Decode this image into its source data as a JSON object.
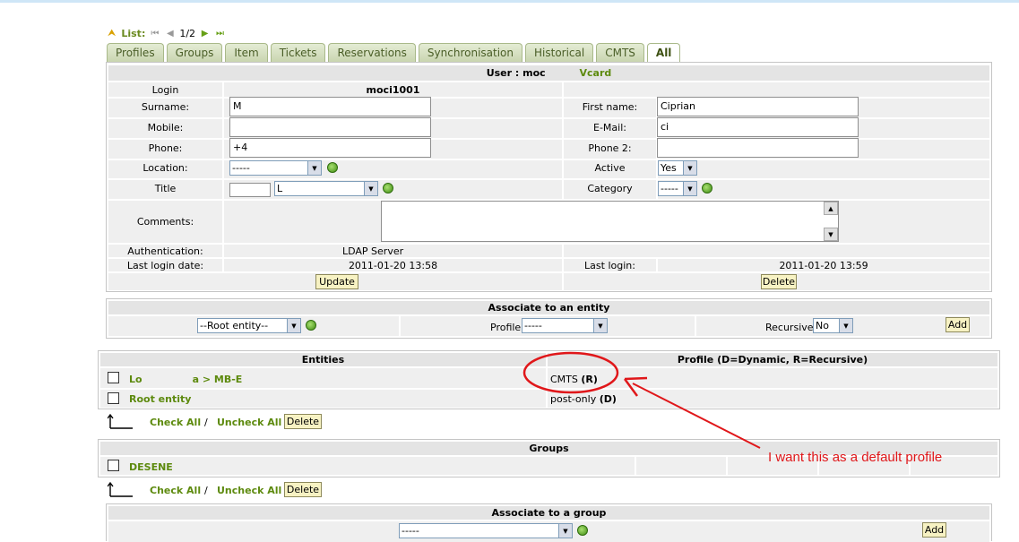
{
  "list_nav": {
    "label": "List:",
    "counter": "1/2"
  },
  "tabs": [
    {
      "label": "Profiles"
    },
    {
      "label": "Groups"
    },
    {
      "label": "Item"
    },
    {
      "label": "Tickets"
    },
    {
      "label": "Reservations"
    },
    {
      "label": "Synchronisation"
    },
    {
      "label": "Historical"
    },
    {
      "label": "CMTS"
    },
    {
      "label": "All"
    }
  ],
  "user_form": {
    "title_prefix": "User : moc",
    "title_suffix": "Vcard",
    "login_label": "Login",
    "login_value": "moci1001",
    "surname_label": "Surname:",
    "surname_value": "M",
    "first_name_label": "First name:",
    "first_name_value": "Ciprian",
    "mobile_label": "Mobile:",
    "mobile_value": "",
    "email_label": "E-Mail:",
    "email_value": "ci",
    "phone_label": "Phone:",
    "phone_value": "+4",
    "phone2_label": "Phone 2:",
    "phone2_value": "",
    "location_label": "Location:",
    "location_value": "-----",
    "active_label": "Active",
    "active_value": "Yes",
    "title_label": "Title",
    "title_value": "",
    "title_select_value": "L",
    "category_label": "Category",
    "category_value": "-----",
    "comments_label": "Comments:",
    "authentication_label": "Authentication:",
    "authentication_value": "LDAP  Server",
    "last_login_date_label": "Last login date:",
    "last_login_date_value": "2011-01-20 13:58",
    "last_login_label": "Last login:",
    "last_login_value": "2011-01-20 13:59",
    "update_button": "Update",
    "delete_button": "Delete"
  },
  "associate_entity": {
    "title": "Associate to an entity",
    "entity_value": "--Root entity--",
    "profile_label": "Profile:",
    "profile_value": "-----",
    "recursive_label": "Recursive:",
    "recursive_value": "No",
    "add_button": "Add"
  },
  "entities_table": {
    "col_entities": "Entities",
    "col_profile": "Profile (D=Dynamic, R=Recursive)",
    "rows": [
      {
        "entity": "Lo",
        "entity_b": "a > MB-E",
        "profile": "CMTS",
        "flag": "(R)"
      },
      {
        "entity": "Root entity",
        "entity_b": "",
        "profile": "post-only",
        "flag": "(D)"
      }
    ]
  },
  "bulk1": {
    "check_all": "Check All",
    "sep": "/",
    "uncheck_all": "Uncheck All",
    "delete": "Delete"
  },
  "groups_table": {
    "title": "Groups",
    "rows": [
      {
        "name": "DESENE"
      }
    ]
  },
  "bulk2": {
    "check_all": "Check All",
    "sep": "/",
    "uncheck_all": "Uncheck All",
    "delete": "Delete"
  },
  "associate_group": {
    "title": "Associate to a group",
    "group_value": "-----",
    "add_button": "Add"
  },
  "annotation": {
    "text": "I want this as a default profile",
    "color": "#e0171a"
  }
}
